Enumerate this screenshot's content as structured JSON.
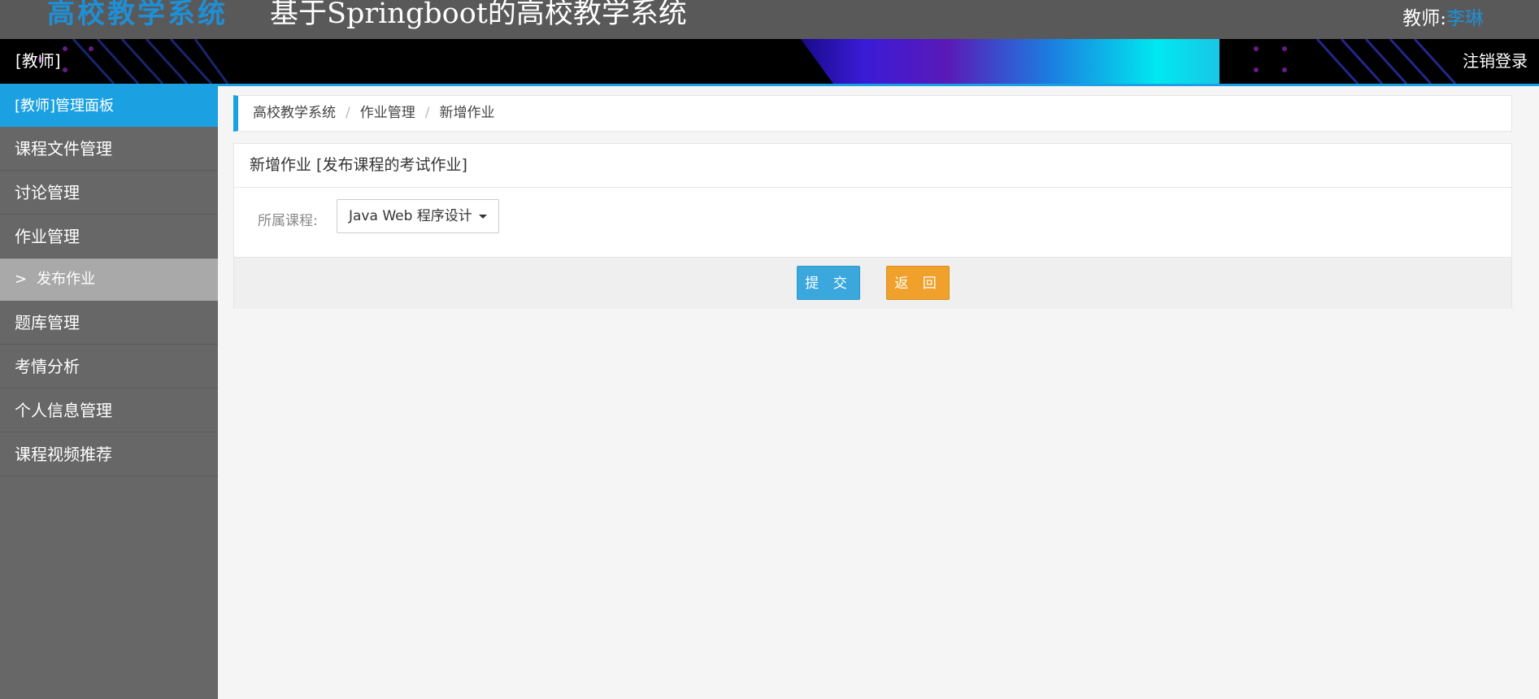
{
  "header": {
    "logo_text": "高校教学系统",
    "system_title": "基于Springboot的高校教学系统",
    "user_prefix": "教师:",
    "user_name": "李琳"
  },
  "banner": {
    "role_label": "[教师]",
    "logout_label": "注销登录"
  },
  "sidebar": {
    "panel_title": "[教师]管理面板",
    "items_before": [
      {
        "label": "课程文件管理"
      },
      {
        "label": "讨论管理"
      },
      {
        "label": "作业管理"
      }
    ],
    "active_sub_item": {
      "arrow": ">",
      "label": "发布作业"
    },
    "items_after": [
      {
        "label": "题库管理"
      },
      {
        "label": "考情分析"
      },
      {
        "label": "个人信息管理"
      },
      {
        "label": "课程视频推荐"
      }
    ]
  },
  "breadcrumb": {
    "items": [
      "高校教学系统",
      "作业管理",
      "新增作业"
    ],
    "separator": "/"
  },
  "form": {
    "title": "新增作业 [发布课程的考试作业]",
    "course_label": "所属课程:",
    "course_value": "Java Web 程序设计",
    "submit_label": "提 交",
    "back_label": "返 回"
  },
  "colors": {
    "accent": "#1ba1e2",
    "submit": "#3aa8dd",
    "back": "#f0a12b",
    "sidebar_bg": "#676767",
    "title_bg": "#595959"
  }
}
